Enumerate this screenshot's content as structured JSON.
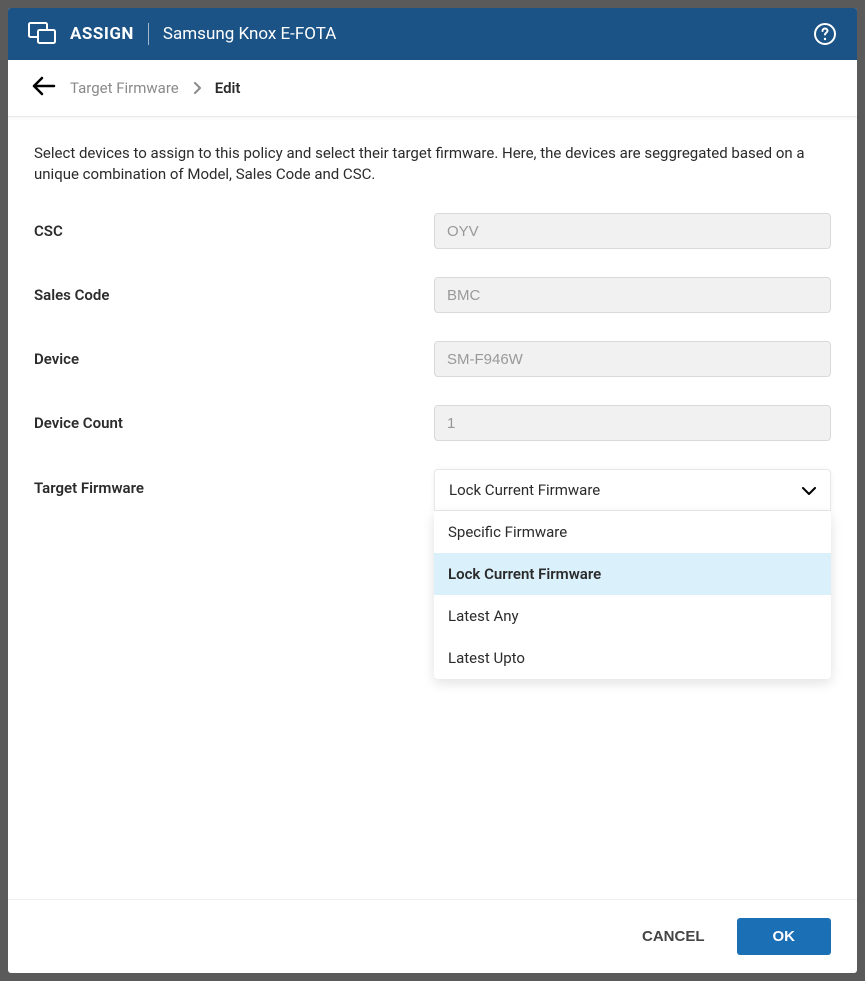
{
  "header": {
    "title": "ASSIGN",
    "subtitle": "Samsung Knox E-FOTA"
  },
  "breadcrumb": {
    "parent": "Target Firmware",
    "current": "Edit"
  },
  "description": "Select devices to assign to this policy and select their target firmware. Here, the devices are seggregated based on a unique combination of Model, Sales Code and CSC.",
  "form": {
    "csc": {
      "label": "CSC",
      "value": "OYV"
    },
    "salesCode": {
      "label": "Sales Code",
      "value": "BMC"
    },
    "device": {
      "label": "Device",
      "value": "SM-F946W"
    },
    "deviceCount": {
      "label": "Device Count",
      "value": "1"
    },
    "targetFirmware": {
      "label": "Target Firmware",
      "selected": "Lock Current Firmware",
      "options": {
        "0": "Specific Firmware",
        "1": "Lock Current Firmware",
        "2": "Latest Any",
        "3": "Latest Upto"
      }
    }
  },
  "footer": {
    "cancel": "CANCEL",
    "ok": "OK"
  }
}
